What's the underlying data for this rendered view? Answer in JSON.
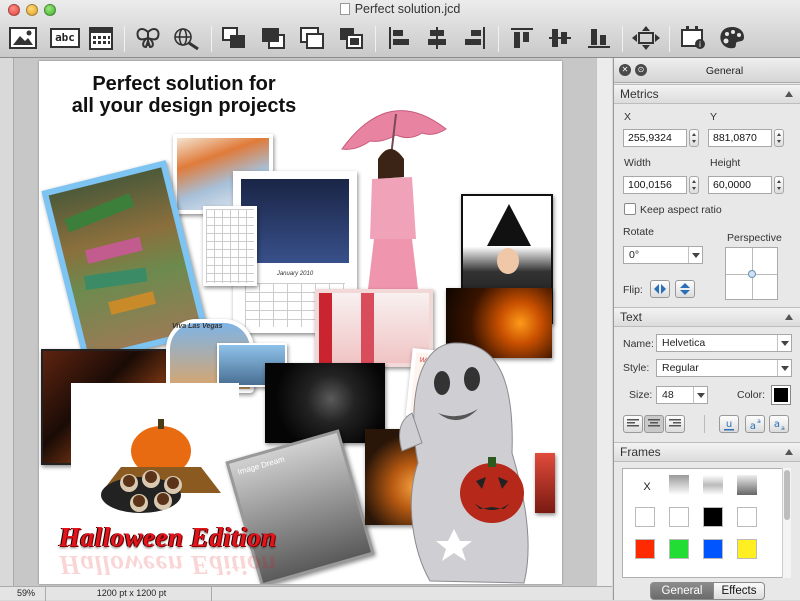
{
  "window": {
    "title": "Perfect solution.jcd"
  },
  "toolbar": {
    "buttons": [
      {
        "icon": "image-icon"
      },
      {
        "icon": "text-icon",
        "label": "abc"
      },
      {
        "icon": "calendar-icon"
      },
      {
        "icon": "butterfly-icon"
      },
      {
        "icon": "search-globe-icon"
      },
      {
        "icon": "bring-front-icon"
      },
      {
        "icon": "bring-forward-icon"
      },
      {
        "icon": "send-backward-icon"
      },
      {
        "icon": "send-back-icon"
      },
      {
        "icon": "align-left-icon"
      },
      {
        "icon": "align-center-icon"
      },
      {
        "icon": "align-right-icon"
      },
      {
        "icon": "align-top-icon"
      },
      {
        "icon": "align-middle-icon"
      },
      {
        "icon": "align-bottom-icon"
      },
      {
        "icon": "move-icon"
      },
      {
        "icon": "inspector-icon"
      },
      {
        "icon": "palette-icon"
      }
    ]
  },
  "canvas": {
    "headline_line1": "Perfect solution for",
    "headline_line2": "all your design projects",
    "calendar_label": "January 2010",
    "viva_label": "Viva Las Vegas",
    "wedo_label": "We love you",
    "image_dream_label": "Image Dream",
    "halloween_text": "Halloween Edition"
  },
  "status": {
    "zoom": "59%",
    "doc_size": "1200 pt x 1200 pt"
  },
  "panel": {
    "title": "General",
    "metrics": {
      "header": "Metrics",
      "x_label": "X",
      "x_value": "255,9324",
      "y_label": "Y",
      "y_value": "881,0870",
      "width_label": "Width",
      "width_value": "100,0156",
      "height_label": "Height",
      "height_value": "60,0000",
      "keep_aspect_label": "Keep aspect ratio",
      "rotate_label": "Rotate",
      "rotate_value": "0°",
      "perspective_label": "Perspective",
      "flip_label": "Flip:"
    },
    "text": {
      "header": "Text",
      "name_label": "Name:",
      "name_value": "Helvetica",
      "style_label": "Style:",
      "style_value": "Regular",
      "size_label": "Size:",
      "size_value": "48",
      "color_label": "Color:",
      "color_value": "#000000"
    },
    "frames": {
      "header": "Frames",
      "none_label": "X",
      "swatches": [
        "#ffffff",
        "#ffffff",
        "#000000",
        "#ffffff",
        "#ff2a00",
        "#22dd33",
        "#0055ff",
        "#ffee22"
      ]
    },
    "tabs": {
      "general": "General",
      "effects": "Effects"
    }
  }
}
